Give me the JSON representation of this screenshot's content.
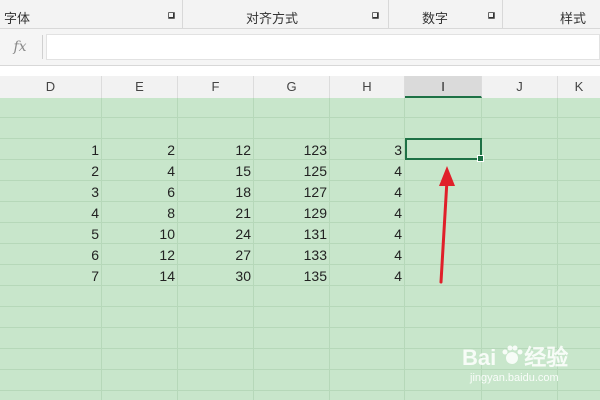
{
  "ribbon": {
    "groups": [
      {
        "label": "字体"
      },
      {
        "label": "对齐方式"
      },
      {
        "label": "数字"
      },
      {
        "label": "样式"
      }
    ]
  },
  "formula_bar": {
    "fx_label": "fx",
    "value": ""
  },
  "columns": [
    "D",
    "E",
    "F",
    "G",
    "H",
    "I",
    "J",
    "K"
  ],
  "active_column": "I",
  "rows": [
    {
      "D": "1",
      "E": "2",
      "F": "12",
      "G": "123",
      "H": "3"
    },
    {
      "D": "2",
      "E": "4",
      "F": "15",
      "G": "125",
      "H": "4"
    },
    {
      "D": "3",
      "E": "6",
      "F": "18",
      "G": "127",
      "H": "4"
    },
    {
      "D": "4",
      "E": "8",
      "F": "21",
      "G": "129",
      "H": "4"
    },
    {
      "D": "5",
      "E": "10",
      "F": "24",
      "G": "131",
      "H": "4"
    },
    {
      "D": "6",
      "E": "12",
      "F": "27",
      "G": "133",
      "H": "4"
    },
    {
      "D": "7",
      "E": "14",
      "F": "30",
      "G": "135",
      "H": "4"
    }
  ],
  "selected_cell": "I",
  "colors": {
    "grid_background": "#c8e6cb",
    "selection_border": "#1e7145",
    "annotation_arrow": "#e0202a"
  },
  "watermark": {
    "brand_left": "Bai",
    "brand_right": "经验",
    "url": "jingyan.baidu.com"
  }
}
